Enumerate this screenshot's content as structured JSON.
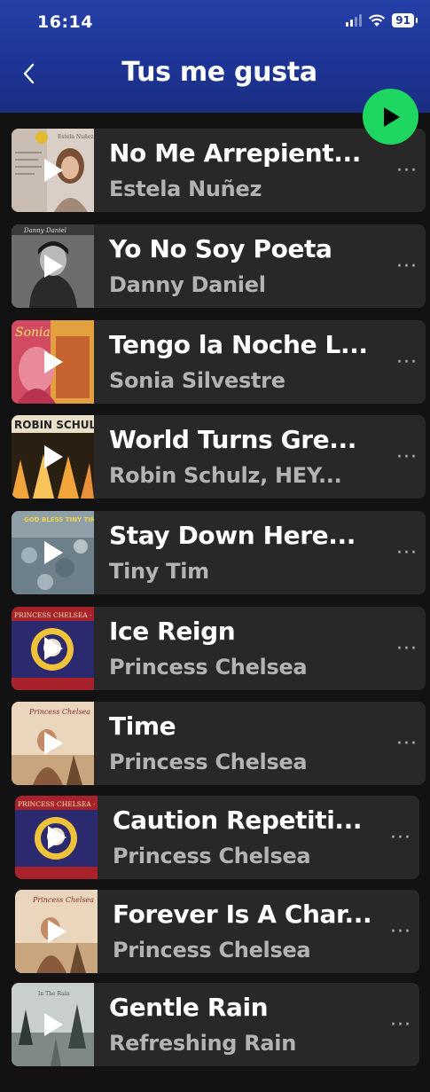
{
  "status_bar": {
    "time": "16:14",
    "battery": "91"
  },
  "header": {
    "title": "Tus me gusta"
  },
  "more_label": "···",
  "tracks": [
    {
      "title": "No Me Arrepient...",
      "artist": "Estela Nuñez"
    },
    {
      "title": "Yo No Soy Poeta",
      "artist": "Danny Daniel"
    },
    {
      "title": "Tengo la Noche L...",
      "artist": "Sonia Silvestre"
    },
    {
      "title": "World Turns Gre...",
      "artist": "Robin Schulz, HEY..."
    },
    {
      "title": "Stay Down Here...",
      "artist": "Tiny Tim"
    },
    {
      "title": "Ice Reign",
      "artist": "Princess Chelsea"
    },
    {
      "title": "Time",
      "artist": "Princess Chelsea"
    },
    {
      "title": "Caution Repetiti...",
      "artist": "Princess Chelsea"
    },
    {
      "title": "Forever Is A Char...",
      "artist": "Princess Chelsea"
    },
    {
      "title": "Gentle Rain",
      "artist": "Refreshing Rain"
    }
  ],
  "covers": [
    {
      "lettering": "Estela Nuñez"
    },
    {
      "lettering": "Danny Daniel"
    },
    {
      "lettering": "Sonia"
    },
    {
      "lettering": "ROBIN SCHULZ"
    },
    {
      "lettering": "GOD BLESS TINY TIM"
    },
    {
      "lettering": "PRINCESS CHELSEA · LIL' GOLDEN BOOK"
    },
    {
      "lettering": "Princess Chelsea"
    },
    {
      "lettering": "PRINCESS CHELSEA · LIL' GOLDEN BOOK"
    },
    {
      "lettering": "Princess Chelsea"
    },
    {
      "lettering": "In The Rain"
    }
  ],
  "colors": {
    "accent": "#1ed760",
    "header": "#1e3596",
    "row": "#282828",
    "background": "#121212",
    "secondary_text": "#b3b3b3"
  }
}
